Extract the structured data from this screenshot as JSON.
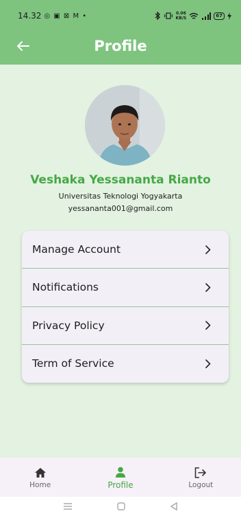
{
  "status_bar": {
    "time": "14.32",
    "left_icons": "◎ ▣ ⊠ M •",
    "data_rate_value": "0.06",
    "data_rate_unit": "KB/S",
    "battery": "67"
  },
  "app_bar": {
    "title": "Profile",
    "back_icon": "arrow-left-icon"
  },
  "profile": {
    "name": "Veshaka Yessananta Rianto",
    "university": "Universitas Teknologi Yogyakarta",
    "email": "yessananta001@gmail.com"
  },
  "menu": {
    "items": [
      {
        "label": "Manage Account",
        "icon": "chevron-right-icon"
      },
      {
        "label": "Notifications",
        "icon": "chevron-right-icon"
      },
      {
        "label": "Privacy Policy",
        "icon": "chevron-right-icon"
      },
      {
        "label": "Term of Service",
        "icon": "chevron-right-icon"
      }
    ]
  },
  "bottom_nav": {
    "items": [
      {
        "label": "Home",
        "icon": "home-icon",
        "active": false
      },
      {
        "label": "Profile",
        "icon": "person-icon",
        "active": true
      },
      {
        "label": "Logout",
        "icon": "logout-icon",
        "active": false
      }
    ]
  },
  "colors": {
    "primary": "#7ec47f",
    "accent_text": "#45a845",
    "background": "#e3f2e1",
    "card": "#f3eff7",
    "nav_bg": "#f6f0f8"
  }
}
